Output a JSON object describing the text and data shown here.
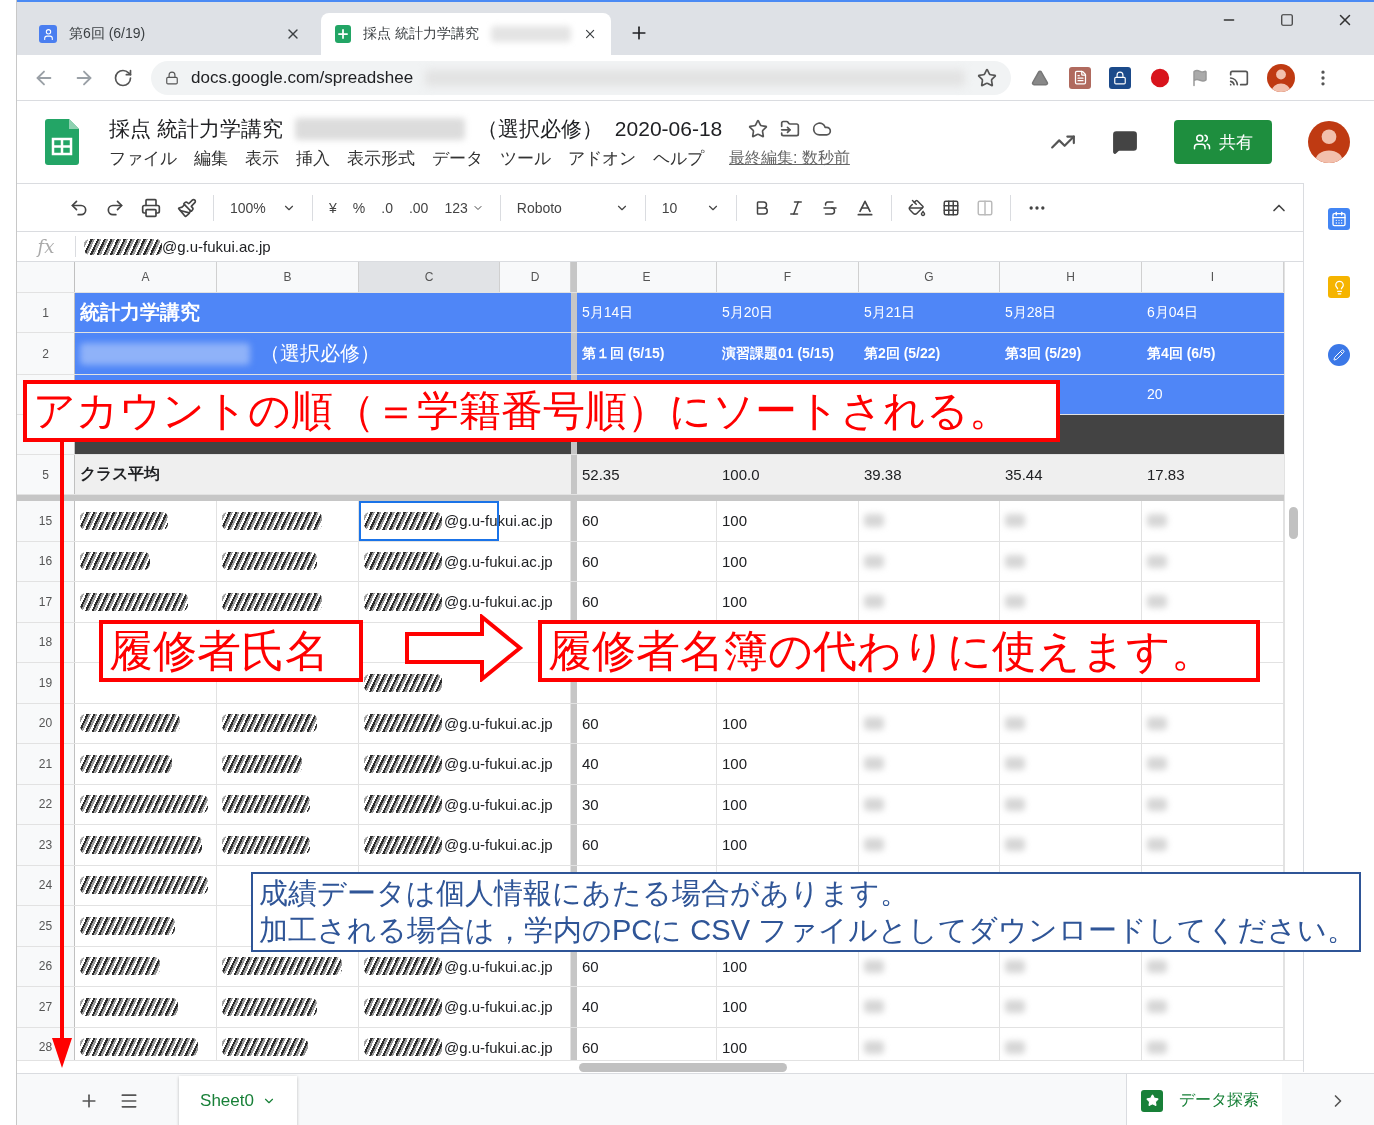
{
  "browser": {
    "tabs": [
      {
        "title": "第6回 (6/19)",
        "selected": false,
        "kind": "contacts"
      },
      {
        "title": "採点 統計力学講究",
        "selected": true,
        "kind": "sheets"
      }
    ],
    "url": "docs.google.com/spreadshee"
  },
  "document": {
    "title": "採点 統計力学講究",
    "title_suffix": "（選択必修）",
    "date": "2020-06-18",
    "menus": [
      "ファイル",
      "編集",
      "表示",
      "挿入",
      "表示形式",
      "データ",
      "ツール",
      "アドオン",
      "ヘルプ"
    ],
    "last_edit": "最終編集: 数秒前",
    "share": "共有"
  },
  "toolbar": {
    "zoom": "100%",
    "currency": "¥",
    "percent": "%",
    "decrease_decimals": ".0",
    "increase_decimals": ".00",
    "number_format": "123",
    "font": "Roboto",
    "font_size": "10"
  },
  "formula_bar": {
    "fx": "fx",
    "value": "@g.u-fukui.ac.jp"
  },
  "columns": [
    {
      "label": "A",
      "selected": false
    },
    {
      "label": "B",
      "selected": false
    },
    {
      "label": "C",
      "selected": true
    },
    {
      "label": "D",
      "selected": false
    },
    {
      "label": "E",
      "selected": false
    },
    {
      "label": "F",
      "selected": false
    },
    {
      "label": "G",
      "selected": false
    },
    {
      "label": "H",
      "selected": false
    },
    {
      "label": "I",
      "selected": false
    }
  ],
  "header_rows": [
    {
      "number": "1",
      "kind": "blue",
      "a": "統計力学講究",
      "redacted_prefix": false,
      "cells": [
        "5月14日",
        "5月20日",
        "5月21日",
        "5月28日",
        "6月04日"
      ]
    },
    {
      "number": "2",
      "kind": "blue",
      "a": "（選択必修）",
      "redacted_prefix": true,
      "cells": [
        "第１回 (5/15)",
        "演習課題01 (5/15)",
        "第2回 (5/22)",
        "第3回 (5/29)",
        "第4回 (6/5)"
      ]
    },
    {
      "kind": "blue",
      "cells": [
        null,
        null,
        null,
        null,
        "20"
      ]
    },
    {
      "kind": "dark"
    },
    {
      "number": "5",
      "kind": "average",
      "a": "クラス平均",
      "cells": [
        "52.35",
        "100.0",
        "39.38",
        "35.44",
        "17.83"
      ]
    }
  ],
  "students": [
    {
      "number": "15",
      "email": "@g.u-fukui.ac.jp",
      "e": "60",
      "f": "100",
      "selected": true
    },
    {
      "number": "16",
      "email": "@g.u-fukui.ac.jp",
      "e": "60",
      "f": "100",
      "selected": false
    },
    {
      "number": "17",
      "email": "@g.u-fukui.ac.jp",
      "e": "60",
      "f": "100",
      "selected": false
    },
    {
      "number": "18",
      "selected": false
    },
    {
      "number": "19",
      "selected": false
    },
    {
      "number": "20",
      "email": "@g.u-fukui.ac.jp",
      "e": "60",
      "f": "100",
      "selected": false
    },
    {
      "number": "21",
      "email": "@g.u-fukui.ac.jp",
      "e": "40",
      "f": "100",
      "selected": false
    },
    {
      "number": "22",
      "email": "@g.u-fukui.ac.jp",
      "e": "30",
      "f": "100",
      "selected": false
    },
    {
      "number": "23",
      "email": "@g.u-fukui.ac.jp",
      "e": "60",
      "f": "100",
      "selected": false
    },
    {
      "number": "24"
    },
    {
      "number": "25"
    },
    {
      "number": "26",
      "email": "@g.u-fukui.ac.jp",
      "e": "60",
      "f": "100",
      "selected": false
    },
    {
      "number": "27",
      "email": "@g.u-fukui.ac.jp",
      "e": "40",
      "f": "100",
      "selected": false
    },
    {
      "number": "28",
      "email": "@g.u-fukui.ac.jp",
      "e": "60",
      "f": "100",
      "selected": false
    }
  ],
  "sheet_bar": {
    "sheet": "Sheet0",
    "explore": "データ探索"
  },
  "annotations": {
    "sort_note": "アカウントの順（＝学籍番号順）にソートされる。",
    "name_label": "履修者氏名",
    "roster_note": "履修者名簿の代わりに使えます。",
    "privacy_note": [
      "成績データは個人情報にあたる場合があります。",
      "加工される場合は，学内のPCに CSV ファイルとしてダウンロードしてください。"
    ]
  }
}
